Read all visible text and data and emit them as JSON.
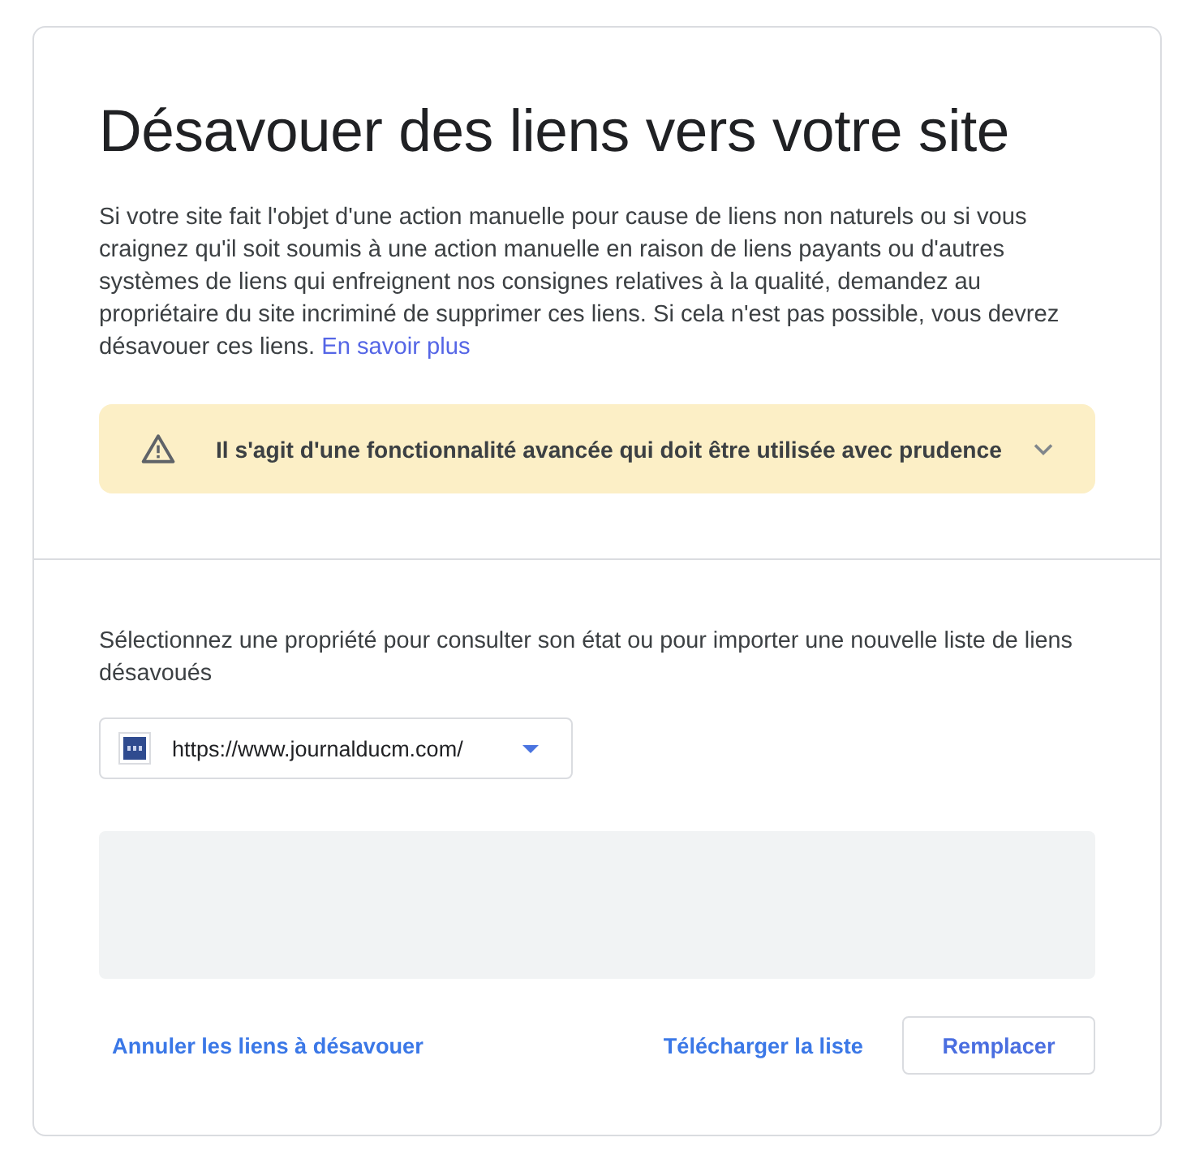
{
  "page": {
    "title": "Désavouer des liens vers votre site",
    "intro": "Si votre site fait l'objet d'une action manuelle pour cause de liens non naturels ou si vous craignez qu'il soit soumis à une action manuelle en raison de liens payants ou d'autres systèmes de liens qui enfreignent nos consignes relatives à la qualité, demandez au propriétaire du site incriminé de supprimer ces liens. Si cela n'est pas possible, vous devrez désavouer ces liens.",
    "learn_more_link": "En savoir plus"
  },
  "warning": {
    "text": "Il s'agit d'une fonctionnalité avancée qui doit être utilisée avec prudence",
    "expanded": false
  },
  "property_section": {
    "instructions": "Sélectionnez une propriété pour consulter son état ou pour importer une nouvelle liste de liens désavoués",
    "property_select": {
      "value": "https://www.journalducm.com/"
    }
  },
  "actions": [
    {
      "label": "Annuler les liens à désavouer",
      "kind": "text"
    },
    {
      "label": "Télécharger la liste",
      "kind": "text"
    },
    {
      "label": "Remplacer",
      "kind": "outlined"
    }
  ]
}
